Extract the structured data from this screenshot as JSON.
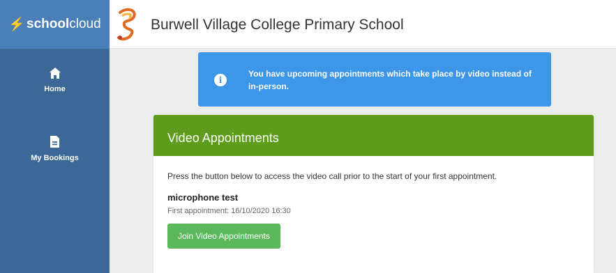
{
  "brand": {
    "bolt": "⚡",
    "school": "school",
    "cloud": "cloud"
  },
  "header": {
    "school_name": "Burwell Village College Primary School"
  },
  "sidebar": {
    "items": [
      {
        "label": "Home",
        "icon": "home-icon"
      },
      {
        "label": "My Bookings",
        "icon": "document-icon"
      }
    ]
  },
  "alert": {
    "icon": "info-icon",
    "message": "You have upcoming appointments which take place by video instead of in-person."
  },
  "card": {
    "title": "Video Appointments",
    "intro": "Press the button below to access the video call prior to the start of your first appointment.",
    "appointment_name": "microphone test",
    "first_appointment": "First appointment: 16/10/2020 16:30",
    "join_label": "Join Video Appointments"
  },
  "colors": {
    "brand_blue": "#4a7fb7",
    "sidebar_blue": "#3b6896",
    "alert_blue": "#3d96e8",
    "header_green": "#5d9d1b",
    "button_green": "#5cb85c",
    "page_gray": "#ececec"
  }
}
